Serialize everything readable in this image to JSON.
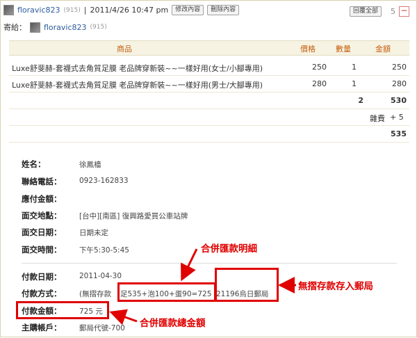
{
  "header": {
    "username": "floravic823",
    "score": "(915)",
    "sep": "|",
    "datetime": "2011/4/26  10:47 pm",
    "edit_btn": "修改內容",
    "delete_btn": "刪除內容",
    "reply_all_btn": "回覆全部",
    "reply_count": "5",
    "collapse": "−"
  },
  "sendto": {
    "label": "寄給：",
    "username": "floravic823",
    "score": "(915)"
  },
  "table": {
    "headers": {
      "product": "商品",
      "price": "價格",
      "qty": "數量",
      "amount": "金額"
    },
    "rows": [
      {
        "product": "Luxe舒斐赫-套襪式去角質足膜 老品牌穿新裝~~一樣好用(女士/小腳專用)",
        "price": "250",
        "qty": "1",
        "amount": "250"
      },
      {
        "product": "Luxe舒斐赫-套襪式去角質足膜 老品牌穿新裝~~一樣好用(男士/大腳專用)",
        "price": "280",
        "qty": "1",
        "amount": "280"
      }
    ],
    "subtotal_qty": "2",
    "subtotal_amount": "530",
    "misc_label": "雜費",
    "misc_value": "+ 5",
    "total": "535"
  },
  "info": {
    "name_label": "姓名：",
    "name_value": "徐鳳檣",
    "phone_label": "聯絡電話：",
    "phone_value": "0923-162833",
    "due_label": "應付金額：",
    "due_value": "",
    "place_label": "面交地點：",
    "place_value": "[台中][南區] 復興路愛買公車站牌",
    "date_label": "面交日期：",
    "date_value": "日期未定",
    "time_label": "面交時間：",
    "time_value": "下午5:30-5:45",
    "paydate_label": "付款日期：",
    "paydate_value": "2011-04-30",
    "paymethod_label": "付款方式：",
    "paymethod_part1": "(無摺存款",
    "paymethod_part2": "足535+泡100+蛋90=725",
    "paymethod_part3": "21196烏日郵局",
    "payamount_label": "付款金額：",
    "payamount_value": "725 元",
    "account_label": "主購帳戶：",
    "account_value": "郵局代號-700"
  },
  "annotations": {
    "merge_detail": "合併匯款明細",
    "deposit": "無摺存款存入郵局",
    "merge_total": "合併匯款總金額"
  },
  "colors": {
    "annotation_red": "#e00000",
    "header_orange": "#c56010",
    "link_blue": "#2c5a9e"
  }
}
